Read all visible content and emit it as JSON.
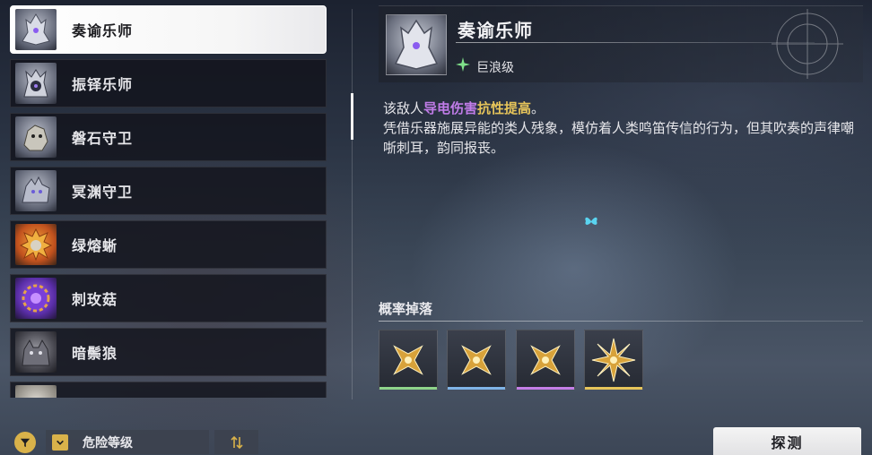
{
  "enemy_list": [
    {
      "name": "奏谕乐师",
      "selected": true,
      "icon": "resonator-maestro-portrait"
    },
    {
      "name": "振铎乐师",
      "selected": false,
      "icon": "bell-maestro-portrait"
    },
    {
      "name": "磐石守卫",
      "selected": false,
      "icon": "stone-guardian-portrait"
    },
    {
      "name": "冥渊守卫",
      "selected": false,
      "icon": "abyss-guardian-portrait"
    },
    {
      "name": "绿熔蜥",
      "selected": false,
      "icon": "flame-lizard-portrait"
    },
    {
      "name": "刺玫菇",
      "selected": false,
      "icon": "rose-mushroom-portrait"
    },
    {
      "name": "暗鬃狼",
      "selected": false,
      "icon": "dark-wolf-portrait"
    },
    {
      "name": "",
      "selected": false,
      "icon": "partial-portrait"
    }
  ],
  "detail": {
    "name": "奏谕乐师",
    "class_label": "巨浪级",
    "desc_prefix": "该敌人",
    "desc_highlight_1": "导电伤害",
    "desc_highlight_2": "抗性提高",
    "desc_suffix": "。",
    "description": "凭借乐器施展异能的类人残象，模仿着人类鸣笛传信的行为，但其吹奏的声律嘲哳刺耳，韵同报丧。"
  },
  "drops": {
    "title": "概率掉落",
    "items": [
      {
        "icon": "gold-shuriken-icon",
        "rarity_color": "#8fd48a"
      },
      {
        "icon": "gold-shuriken-icon",
        "rarity_color": "#7fb3e6"
      },
      {
        "icon": "gold-shuriken-icon",
        "rarity_color": "#c47ee6"
      },
      {
        "icon": "gold-shuriken-icon",
        "rarity_color": "#e6c45a"
      }
    ]
  },
  "bottom_bar": {
    "sort_label": "危险等级",
    "detect_label": "探测"
  },
  "colors": {
    "accent_gold": "#d9b24a",
    "highlight_purple": "#c07ce8",
    "highlight_gold": "#e6c45a"
  }
}
